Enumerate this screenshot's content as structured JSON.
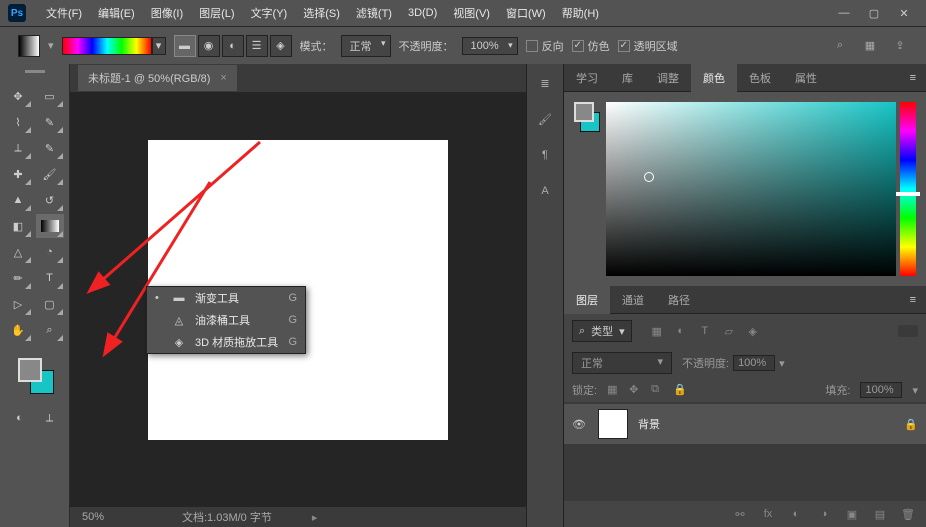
{
  "menubar": {
    "items": [
      "文件(F)",
      "编辑(E)",
      "图像(I)",
      "图层(L)",
      "文字(Y)",
      "选择(S)",
      "滤镜(T)",
      "3D(D)",
      "视图(V)",
      "窗口(W)",
      "帮助(H)"
    ]
  },
  "optionsbar": {
    "mode_label": "模式：",
    "mode_value": "正常",
    "opacity_label": "不透明度：",
    "opacity_value": "100%",
    "reverse_label": "反向",
    "dither_label": "仿色",
    "transparency_label": "透明区域"
  },
  "document": {
    "tab_title": "未标题-1 @ 50%(RGB/8)"
  },
  "flyout": {
    "items": [
      {
        "label": "渐变工具",
        "key": "G",
        "marked": true
      },
      {
        "label": "油漆桶工具",
        "key": "G",
        "marked": false
      },
      {
        "label": "3D 材质拖放工具",
        "key": "G",
        "marked": false
      }
    ]
  },
  "statusbar": {
    "zoom": "50%",
    "doc_info": "文档:1.03M/0 字节"
  },
  "panels": {
    "top_tabs": [
      "学习",
      "库",
      "调整",
      "颜色",
      "色板",
      "属性"
    ],
    "top_active": 3,
    "layers_tabs": [
      "图层",
      "通道",
      "路径"
    ],
    "layers_active": 0,
    "filter_label": "类型",
    "blend_mode": "正常",
    "blend_opacity_label": "不透明度:",
    "blend_opacity": "100%",
    "lock_label": "锁定:",
    "fill_label": "填充:",
    "fill_value": "100%",
    "layer": {
      "name": "背景"
    }
  },
  "chart_data": null
}
